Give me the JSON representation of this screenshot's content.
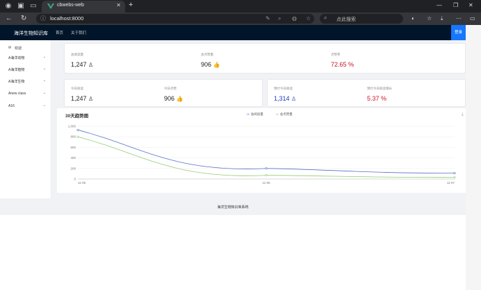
{
  "browser": {
    "tab_title": "cbwebs-web",
    "url": "localhost:8000",
    "search_placeholder": "点此搜索",
    "new_tab": "+",
    "close": "✕"
  },
  "app": {
    "logo": "海洋生物知识库",
    "nav": [
      "首页",
      "关于我们"
    ],
    "login": "登录"
  },
  "sidebar": {
    "items": [
      {
        "label": "欢迎",
        "icon": "mail-icon",
        "chev": ""
      },
      {
        "label": "A海洋动物",
        "chev": "⌄"
      },
      {
        "label": "A海洋植物",
        "chev": "⌄"
      },
      {
        "label": "A海洋生物",
        "chev": "⌄"
      },
      {
        "label": "Anew class",
        "chev": "⌄"
      },
      {
        "label": "A16",
        "chev": "⌄"
      }
    ]
  },
  "stats": {
    "total_views_label": "总阅读量",
    "total_views": "1,247",
    "total_likes_label": "总点赞量",
    "total_likes": "906",
    "like_rate_label": "点赞率",
    "like_rate": "72.65 %",
    "today_views_label": "今日阅读",
    "today_views": "1,247",
    "today_likes_label": "今日点赞",
    "today_likes": "906",
    "forecast_views_label": "预计今日阅读",
    "forecast_views": "1,314",
    "forecast_growth_label": "预计今日阅读增长",
    "forecast_growth": "5.37 %"
  },
  "chart_data": {
    "type": "line",
    "title": "30天趋势图",
    "x": [
      "11-05",
      "11-06",
      "11-07"
    ],
    "series": [
      {
        "name": "总阅读量",
        "values": [
          930,
          200,
          110
        ],
        "color": "#5470c6"
      },
      {
        "name": "总点赞量",
        "values": [
          800,
          70,
          30
        ],
        "color": "#91cc75"
      }
    ],
    "ylim": [
      0,
      1000
    ],
    "yticks": [
      0,
      200,
      400,
      600,
      800,
      "1,000"
    ],
    "grid": true,
    "legend_position": "top-right"
  },
  "footer": {
    "text": "海洋生物知识库系统"
  }
}
